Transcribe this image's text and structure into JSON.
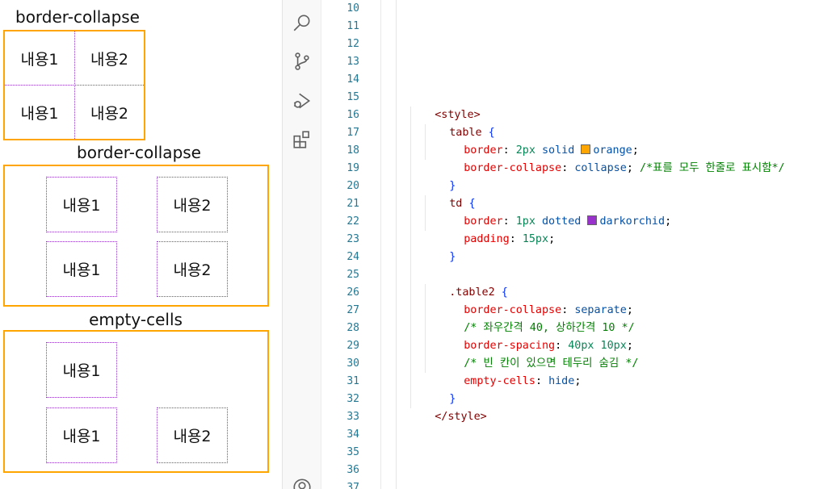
{
  "preview": {
    "table1": {
      "caption": "border-collapse",
      "rows": [
        [
          "내용1",
          "내용2"
        ],
        [
          "내용1",
          "내용2"
        ]
      ]
    },
    "table2": {
      "caption": "border-collapse",
      "rows": [
        [
          "내용1",
          "내용2"
        ],
        [
          "내용1",
          "내용2"
        ]
      ]
    },
    "table3": {
      "caption": "empty-cells",
      "rows": [
        [
          "내용1",
          ""
        ],
        [
          "내용1",
          "내용2"
        ]
      ]
    }
  },
  "activity_bar": {
    "icons": [
      "search-icon",
      "source-control-icon",
      "run-debug-icon",
      "extensions-icon",
      "account-icon"
    ]
  },
  "editor": {
    "line_numbers": [
      "10",
      "11",
      "12",
      "13",
      "14",
      "15",
      "16",
      "17",
      "18",
      "19",
      "20",
      "21",
      "22",
      "23",
      "24",
      "25",
      "26",
      "27",
      "28",
      "29",
      "30",
      "31",
      "32",
      "33",
      "34",
      "35",
      "36",
      "37"
    ],
    "code": {
      "l15": "<style>",
      "l16_sel": "table",
      "l16_br": "{",
      "l17_prop": "border",
      "l17_num": "2px",
      "l17_val": "solid",
      "l17_color": "orange",
      "l18_prop": "border-collapse",
      "l18_val": "collapse",
      "l18_com": "/*표를 모두 한줄로 표시함*/",
      "l19_br": "}",
      "l20_sel": "td",
      "l20_br": "{",
      "l21_prop": "border",
      "l21_num": "1px",
      "l21_val": "dotted",
      "l21_color": "darkorchid",
      "l22_prop": "padding",
      "l22_num": "15px",
      "l23_br": "}",
      "l25_sel": ".table2",
      "l25_br": "{",
      "l26_prop": "border-collapse",
      "l26_val": "separate",
      "l27_com": "/* 좌우간격 40, 상하간격 10 */",
      "l28_prop": "border-spacing",
      "l28_num": "40px 10px",
      "l29_com": "/* 빈 칸이 있으면 테두리 숨김 */",
      "l30_prop": "empty-cells",
      "l30_val": "hide",
      "l31_br": "}",
      "l32": "</style>"
    },
    "colors": {
      "orange": "#ffa500",
      "darkorchid": "#9932cc"
    }
  }
}
